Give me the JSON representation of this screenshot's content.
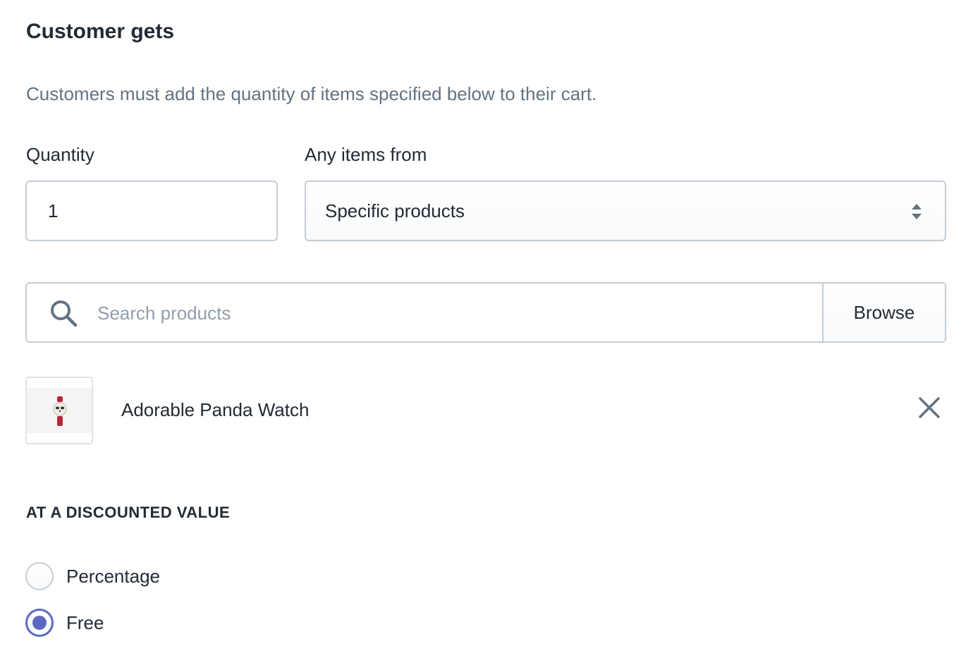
{
  "section": {
    "title": "Customer gets",
    "help_text": "Customers must add the quantity of items specified below to their cart."
  },
  "quantity": {
    "label": "Quantity",
    "value": "1"
  },
  "items_from": {
    "label": "Any items from",
    "selected": "Specific products",
    "icon": "select-arrows-icon"
  },
  "search": {
    "placeholder": "Search products",
    "icon": "search-icon",
    "browse_label": "Browse"
  },
  "selected_products": [
    {
      "name": "Adorable Panda Watch",
      "remove_icon": "close-icon"
    }
  ],
  "discount": {
    "heading": "AT A DISCOUNTED VALUE",
    "options": [
      {
        "label": "Percentage",
        "checked": false
      },
      {
        "label": "Free",
        "checked": true
      }
    ]
  },
  "colors": {
    "text": "#212b36",
    "subdued_text": "#637381",
    "border": "#c4cdd5",
    "accent": "#5c6ac4"
  }
}
